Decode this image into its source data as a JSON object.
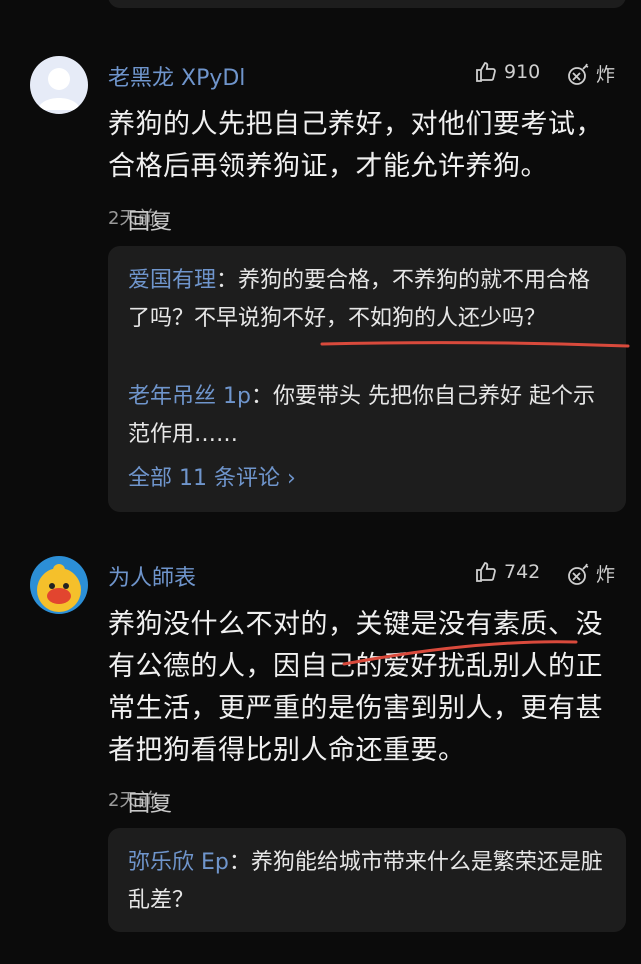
{
  "comments": [
    {
      "username": "老黑龙 XPyDl",
      "likes": "910",
      "bomb_label": "炸",
      "text": "养狗的人先把自己养好，对他们要考试，合格后再领养狗证，才能允许养狗。",
      "time": "2天前",
      "dot": "·",
      "reply_label": "回复",
      "replies": [
        {
          "author": "爱国有理",
          "text": "：养狗的要合格，不养狗的就不用合格了吗？不早说狗不好，不如狗的人还少吗？"
        },
        {
          "author": "老年吊丝 1p",
          "text": "：你要带头 先把你自己养好 起个示范作用……"
        }
      ],
      "see_all": "全部 11 条评论 ›"
    },
    {
      "username": "为人師表",
      "likes": "742",
      "bomb_label": "炸",
      "text": "养狗没什么不对的，关键是没有素质、没有公德的人，因自己的爱好扰乱别人的正常生活，更严重的是伤害到别人，更有甚者把狗看得比别人命还重要。",
      "time": "2天前",
      "dot": "·",
      "reply_label": "回复",
      "replies": [
        {
          "author": "弥乐欣 Ep",
          "text": "：养狗能给城市带来什么是繁荣还是脏乱差？"
        }
      ]
    }
  ],
  "colors": {
    "background": "#0b0b0b",
    "username": "#6f95cc",
    "reply_bg": "#1d1d1d",
    "underline": "#d94a3c"
  },
  "icons": {
    "like": "thumbs-up-icon",
    "bomb": "bomb-icon"
  }
}
